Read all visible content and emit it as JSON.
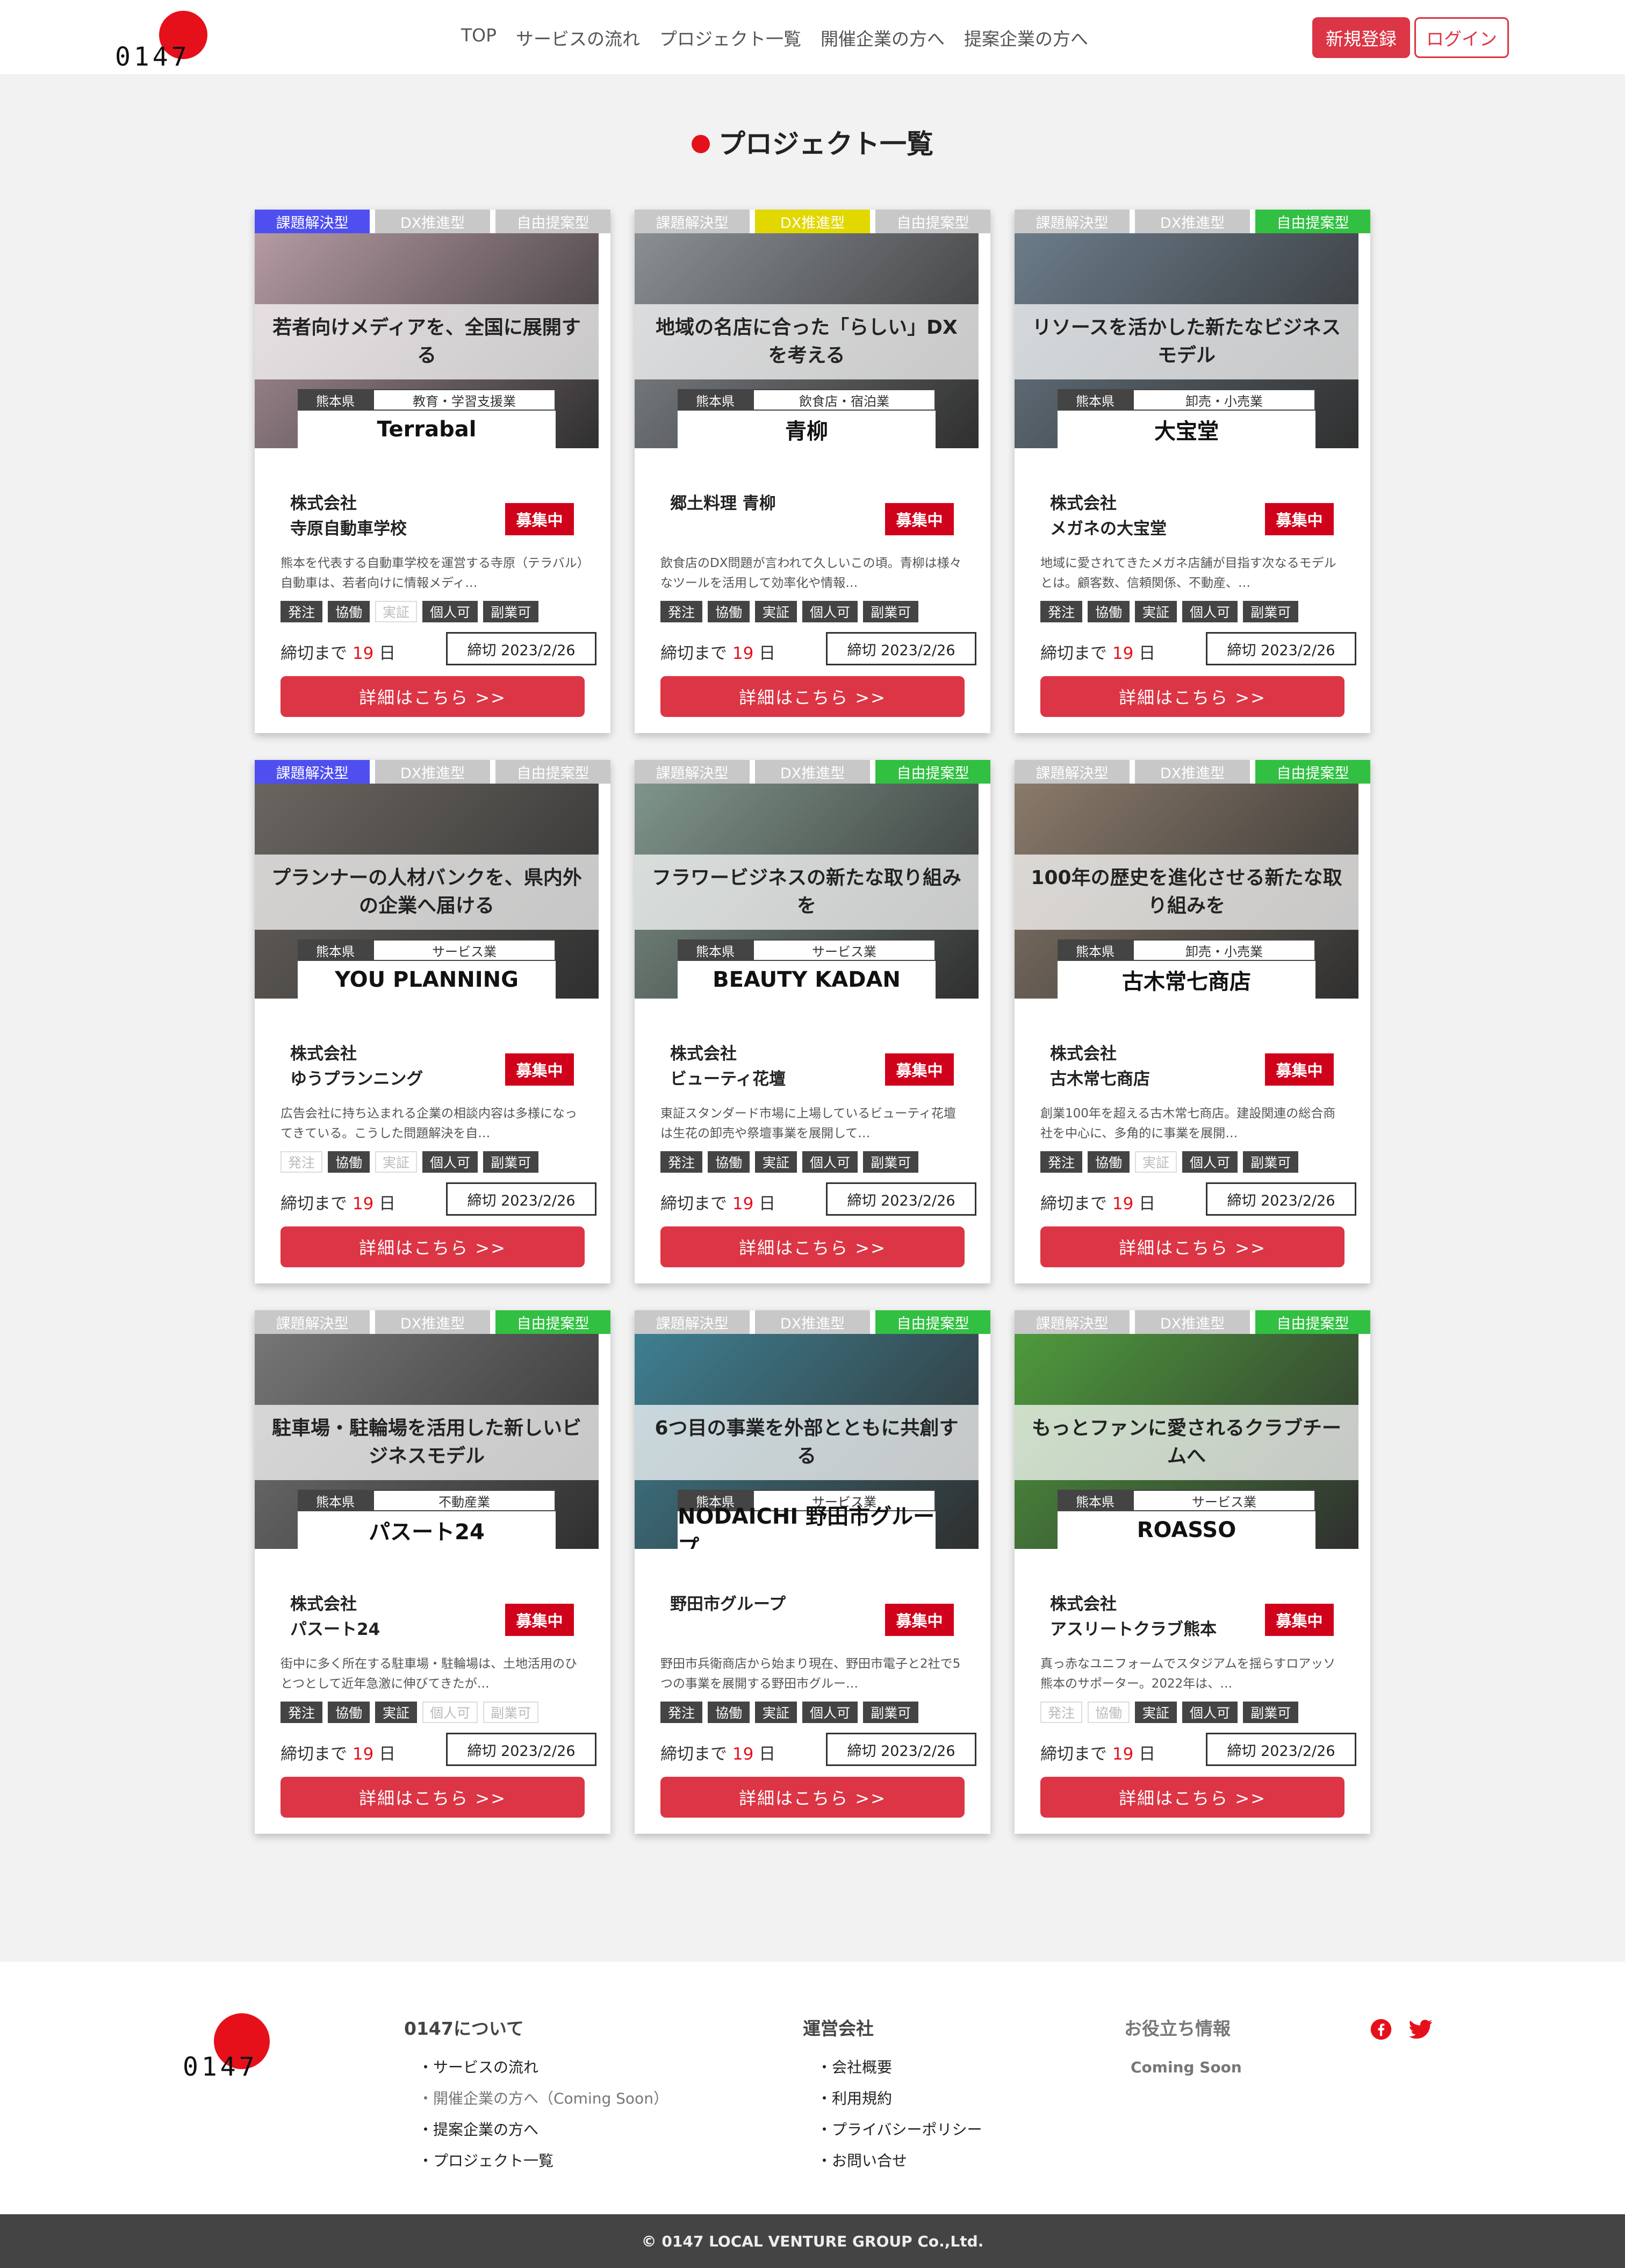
{
  "brand": {
    "logo_text": "0147",
    "accent": "#dc3545",
    "sun": "#e6101a"
  },
  "nav": {
    "items": [
      "TOP",
      "サービスの流れ",
      "プロジェクト一覧",
      "開催企業の方へ",
      "提案企業の方へ"
    ]
  },
  "header": {
    "register_label": "新規登録",
    "login_label": "ログイン"
  },
  "page": {
    "title": "プロジェクト一覧"
  },
  "tag_labels": [
    "課題解決型",
    "DX推進型",
    "自由提案型"
  ],
  "cards": [
    {
      "active_tag": 0,
      "title": "若者向けメディアを、全国に展開する",
      "prefecture": "熊本県",
      "industry": "教育・学習支援業",
      "logo_text": "Terrabal",
      "company": "株式会社\n寺原自動車学校",
      "status": "募集中",
      "desc": "熊本を代表する自動車学校を運営する寺原（テラバル）自動車は、若者向けに情報メディ…",
      "flags": [
        {
          "label": "発注",
          "on": true
        },
        {
          "label": "協働",
          "on": true
        },
        {
          "label": "実証",
          "on": false
        },
        {
          "label": "個人可",
          "on": true
        },
        {
          "label": "副業可",
          "on": true
        }
      ],
      "days_prefix": "締切まで",
      "days": "19",
      "days_suffix": "日",
      "deadline": "締切 2023/2/26",
      "button": "詳細はこちら >>",
      "bg": "#b59aa3"
    },
    {
      "active_tag": 1,
      "title": "地域の名店に合った「らしい」DXを考える",
      "prefecture": "熊本県",
      "industry": "飲食店・宿泊業",
      "logo_text": "青柳",
      "company": "郷土料理 青柳",
      "status": "募集中",
      "desc": "飲食店のDX問題が言われて久しいこの頃。青柳は様々なツールを活用して効率化や情報…",
      "flags": [
        {
          "label": "発注",
          "on": true
        },
        {
          "label": "協働",
          "on": true
        },
        {
          "label": "実証",
          "on": true
        },
        {
          "label": "個人可",
          "on": true
        },
        {
          "label": "副業可",
          "on": true
        }
      ],
      "days_prefix": "締切まで",
      "days": "19",
      "days_suffix": "日",
      "deadline": "締切 2023/2/26",
      "button": "詳細はこちら >>",
      "bg": "#8a8f94"
    },
    {
      "active_tag": 2,
      "title": "リソースを活かした新たなビジネスモデル",
      "prefecture": "熊本県",
      "industry": "卸売・小売業",
      "logo_text": "大宝堂",
      "company": "株式会社\nメガネの大宝堂",
      "status": "募集中",
      "desc": "地域に愛されてきたメガネ店舗が目指す次なるモデルとは。顧客数、信頼関係、不動産、…",
      "flags": [
        {
          "label": "発注",
          "on": true
        },
        {
          "label": "協働",
          "on": true
        },
        {
          "label": "実証",
          "on": true
        },
        {
          "label": "個人可",
          "on": true
        },
        {
          "label": "副業可",
          "on": true
        }
      ],
      "days_prefix": "締切まで",
      "days": "19",
      "days_suffix": "日",
      "deadline": "締切 2023/2/26",
      "button": "詳細はこちら >>",
      "bg": "#6b7c8a"
    },
    {
      "active_tag": 0,
      "title": "プランナーの人材バンクを、県内外の企業へ届ける",
      "prefecture": "熊本県",
      "industry": "サービス業",
      "logo_text": "YOU PLANNING",
      "company": "株式会社\nゆうプランニング",
      "status": "募集中",
      "desc": "広告会社に持ち込まれる企業の相談内容は多様になってきている。こうした問題解決を自…",
      "flags": [
        {
          "label": "発注",
          "on": false
        },
        {
          "label": "協働",
          "on": true
        },
        {
          "label": "実証",
          "on": false
        },
        {
          "label": "個人可",
          "on": true
        },
        {
          "label": "副業可",
          "on": true
        }
      ],
      "days_prefix": "締切まで",
      "days": "19",
      "days_suffix": "日",
      "deadline": "締切 2023/2/26",
      "button": "詳細はこちら >>",
      "bg": "#6a6560"
    },
    {
      "active_tag": 2,
      "title": "フラワービジネスの新たな取り組みを",
      "prefecture": "熊本県",
      "industry": "サービス業",
      "logo_text": "BEAUTY KADAN",
      "company": "株式会社\nビューティ花壇",
      "status": "募集中",
      "desc": "東証スタンダード市場に上場しているビューティ花壇は生花の卸売や祭壇事業を展開して…",
      "flags": [
        {
          "label": "発注",
          "on": true
        },
        {
          "label": "協働",
          "on": true
        },
        {
          "label": "実証",
          "on": true
        },
        {
          "label": "個人可",
          "on": true
        },
        {
          "label": "副業可",
          "on": true
        }
      ],
      "days_prefix": "締切まで",
      "days": "19",
      "days_suffix": "日",
      "deadline": "締切 2023/2/26",
      "button": "詳細はこちら >>",
      "bg": "#7f958b"
    },
    {
      "active_tag": 2,
      "title": "100年の歴史を進化させる新たな取り組みを",
      "prefecture": "熊本県",
      "industry": "卸売・小売業",
      "logo_text": "古木常七商店",
      "company": "株式会社\n古木常七商店",
      "status": "募集中",
      "desc": "創業100年を超える古木常七商店。建設関連の総合商社を中心に、多角的に事業を展開…",
      "flags": [
        {
          "label": "発注",
          "on": true
        },
        {
          "label": "協働",
          "on": true
        },
        {
          "label": "実証",
          "on": false
        },
        {
          "label": "個人可",
          "on": true
        },
        {
          "label": "副業可",
          "on": true
        }
      ],
      "days_prefix": "締切まで",
      "days": "19",
      "days_suffix": "日",
      "deadline": "締切 2023/2/26",
      "button": "詳細はこちら >>",
      "bg": "#8a7a6a"
    },
    {
      "active_tag": 2,
      "title": "駐車場・駐輪場を活用した新しいビジネスモデル",
      "prefecture": "熊本県",
      "industry": "不動産業",
      "logo_text": "パスート24",
      "company": "株式会社\nパスート24",
      "status": "募集中",
      "desc": "街中に多く所在する駐車場・駐輪場は、土地活用のひとつとして近年急激に伸びてきたが…",
      "flags": [
        {
          "label": "発注",
          "on": true
        },
        {
          "label": "協働",
          "on": true
        },
        {
          "label": "実証",
          "on": true
        },
        {
          "label": "個人可",
          "on": false
        },
        {
          "label": "副業可",
          "on": false
        }
      ],
      "days_prefix": "締切まで",
      "days": "19",
      "days_suffix": "日",
      "deadline": "締切 2023/2/26",
      "button": "詳細はこちら >>",
      "bg": "#767676"
    },
    {
      "active_tag": 2,
      "title": "6つ目の事業を外部とともに共創する",
      "prefecture": "熊本県",
      "industry": "サービス業",
      "logo_text": "NODAICHI 野田市グループ",
      "company": "野田市グループ",
      "status": "募集中",
      "desc": "野田市兵衛商店から始まり現在、野田市電子と2社で5つの事業を展開する野田市グルー…",
      "flags": [
        {
          "label": "発注",
          "on": true
        },
        {
          "label": "協働",
          "on": true
        },
        {
          "label": "実証",
          "on": true
        },
        {
          "label": "個人可",
          "on": true
        },
        {
          "label": "副業可",
          "on": true
        }
      ],
      "days_prefix": "締切まで",
      "days": "19",
      "days_suffix": "日",
      "deadline": "締切 2023/2/26",
      "button": "詳細はこちら >>",
      "bg": "#3e7f91"
    },
    {
      "active_tag": 2,
      "title": "もっとファンに愛されるクラブチームへ",
      "prefecture": "熊本県",
      "industry": "サービス業",
      "logo_text": "ROASSO",
      "company": "株式会社\nアスリートクラブ熊本",
      "status": "募集中",
      "desc": "真っ赤なユニフォームでスタジアムを揺らすロアッソ熊本のサポーター。2022年は、…",
      "flags": [
        {
          "label": "発注",
          "on": false
        },
        {
          "label": "協働",
          "on": false
        },
        {
          "label": "実証",
          "on": true
        },
        {
          "label": "個人可",
          "on": true
        },
        {
          "label": "副業可",
          "on": true
        }
      ],
      "days_prefix": "締切まで",
      "days": "19",
      "days_suffix": "日",
      "deadline": "締切 2023/2/26",
      "button": "詳細はこちら >>",
      "bg": "#4e9a3c"
    }
  ],
  "footer": {
    "col1": {
      "title": "0147について",
      "items": [
        "・サービスの流れ",
        "・開催企業の方へ（Coming Soon）",
        "・提案企業の方へ",
        "・プロジェクト一覧"
      ]
    },
    "col2": {
      "title": "運営会社",
      "items": [
        "・会社概要",
        "・利用規約",
        "・プライバシーポリシー",
        "・お問い合せ"
      ]
    },
    "col3": {
      "title": "お役立ち情報",
      "coming": "Coming Soon"
    },
    "copyright": "© 0147 LOCAL VENTURE GROUP Co.,Ltd."
  },
  "icons": {
    "facebook": "facebook-icon",
    "twitter": "twitter-icon"
  }
}
